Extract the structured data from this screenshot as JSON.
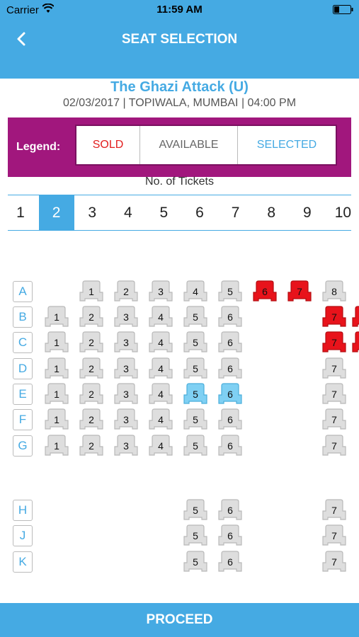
{
  "status_bar": {
    "carrier": "Carrier",
    "time": "11:59 AM"
  },
  "header": {
    "title": "SEAT SELECTION",
    "back_icon": "chevron-left-icon"
  },
  "movie": {
    "title": "The Ghazi Attack (U)",
    "details": "02/03/2017 | TOPIWALA, MUMBAI | 04:00 PM"
  },
  "legend": {
    "label": "Legend:",
    "sold": "SOLD",
    "available": "AVAILABLE",
    "selected": "SELECTED"
  },
  "tickets": {
    "label": "No. of Tickets",
    "options": [
      "1",
      "2",
      "3",
      "4",
      "5",
      "6",
      "7",
      "8",
      "9",
      "10"
    ],
    "selected": "2"
  },
  "colors": {
    "available": "#dedede",
    "sold": "#e8131b",
    "selected": "#7fd0f3",
    "accent": "#45aae3",
    "legend_bg": "#a1177d"
  },
  "seat_rows": [
    {
      "row": "A",
      "seats": [
        {
          "num": "1",
          "status": "available"
        },
        {
          "num": "2",
          "status": "available"
        },
        {
          "num": "3",
          "status": "available"
        },
        {
          "num": "4",
          "status": "available"
        },
        {
          "num": "5",
          "status": "available"
        },
        {
          "num": "6",
          "status": "sold"
        },
        {
          "num": "7",
          "status": "sold"
        },
        {
          "num": "8",
          "status": "available"
        }
      ]
    },
    {
      "row": "B",
      "seats": [
        {
          "num": "1",
          "status": "available"
        },
        {
          "num": "2",
          "status": "available"
        },
        {
          "num": "3",
          "status": "available"
        },
        {
          "num": "4",
          "status": "available"
        },
        {
          "num": "5",
          "status": "available"
        },
        {
          "num": "6",
          "status": "available"
        },
        {
          "num": "7",
          "status": "sold"
        },
        {
          "num": "",
          "status": "sold"
        }
      ]
    },
    {
      "row": "C",
      "seats": [
        {
          "num": "1",
          "status": "available"
        },
        {
          "num": "2",
          "status": "available"
        },
        {
          "num": "3",
          "status": "available"
        },
        {
          "num": "4",
          "status": "available"
        },
        {
          "num": "5",
          "status": "available"
        },
        {
          "num": "6",
          "status": "available"
        },
        {
          "num": "7",
          "status": "sold"
        },
        {
          "num": "",
          "status": "sold"
        }
      ]
    },
    {
      "row": "D",
      "seats": [
        {
          "num": "1",
          "status": "available"
        },
        {
          "num": "2",
          "status": "available"
        },
        {
          "num": "3",
          "status": "available"
        },
        {
          "num": "4",
          "status": "available"
        },
        {
          "num": "5",
          "status": "available"
        },
        {
          "num": "6",
          "status": "available"
        },
        {
          "num": "7",
          "status": "available"
        }
      ]
    },
    {
      "row": "E",
      "seats": [
        {
          "num": "1",
          "status": "available"
        },
        {
          "num": "2",
          "status": "available"
        },
        {
          "num": "3",
          "status": "available"
        },
        {
          "num": "4",
          "status": "available"
        },
        {
          "num": "5",
          "status": "selected"
        },
        {
          "num": "6",
          "status": "selected"
        },
        {
          "num": "7",
          "status": "available"
        }
      ]
    },
    {
      "row": "F",
      "seats": [
        {
          "num": "1",
          "status": "available"
        },
        {
          "num": "2",
          "status": "available"
        },
        {
          "num": "3",
          "status": "available"
        },
        {
          "num": "4",
          "status": "available"
        },
        {
          "num": "5",
          "status": "available"
        },
        {
          "num": "6",
          "status": "available"
        },
        {
          "num": "7",
          "status": "available"
        }
      ]
    },
    {
      "row": "G",
      "seats": [
        {
          "num": "1",
          "status": "available"
        },
        {
          "num": "2",
          "status": "available"
        },
        {
          "num": "3",
          "status": "available"
        },
        {
          "num": "4",
          "status": "available"
        },
        {
          "num": "5",
          "status": "available"
        },
        {
          "num": "6",
          "status": "available"
        },
        {
          "num": "7",
          "status": "available"
        }
      ]
    },
    {
      "row": "H",
      "seats": [
        {
          "num": "5",
          "status": "available"
        },
        {
          "num": "6",
          "status": "available"
        },
        {
          "num": "7",
          "status": "available"
        }
      ]
    },
    {
      "row": "J",
      "seats": [
        {
          "num": "5",
          "status": "available"
        },
        {
          "num": "6",
          "status": "available"
        },
        {
          "num": "7",
          "status": "available"
        }
      ]
    },
    {
      "row": "K",
      "seats": [
        {
          "num": "5",
          "status": "available"
        },
        {
          "num": "6",
          "status": "available"
        },
        {
          "num": "7",
          "status": "available"
        }
      ]
    }
  ],
  "footer": {
    "proceed_label": "PROCEED"
  }
}
